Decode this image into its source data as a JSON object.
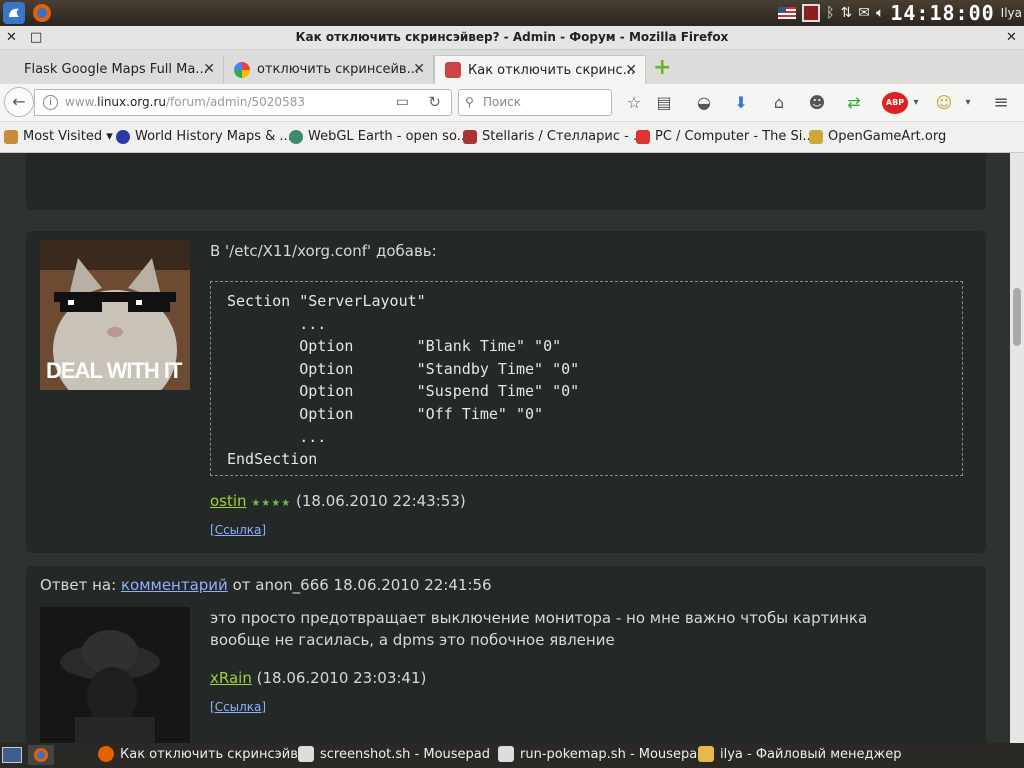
{
  "system_bar": {
    "clock": "14:18:00",
    "user": "Ilya"
  },
  "window": {
    "title": "Как отключить скринсэйвер? - Admin - Форум - Mozilla Firefox",
    "close_symbol": "✕",
    "maximize_symbol": "□",
    "minimize_symbol": "✕"
  },
  "tabs": [
    {
      "label": "Flask Google Maps Full Ma...",
      "active": false
    },
    {
      "label": "отключить скринсейв...",
      "active": false
    },
    {
      "label": "Как отключить скринс...",
      "active": true
    }
  ],
  "new_tab_symbol": "+",
  "navbar": {
    "url_prefix": "www.",
    "url_domain": "linux.org.ru",
    "url_path": "/forum/admin/5020583",
    "search_placeholder": "Поиск"
  },
  "bookmarks": [
    {
      "label": "Most Visited ▾"
    },
    {
      "label": "World History Maps & ..."
    },
    {
      "label": "WebGL Earth - open so..."
    },
    {
      "label": "Stellaris / Стелларис - ..."
    },
    {
      "label": "PC / Computer - The Si..."
    },
    {
      "label": "OpenGameArt.org"
    }
  ],
  "post1": {
    "intro": "В '/etc/X11/xorg.conf' добавь:",
    "code": "Section \"ServerLayout\"\n        ...\n        Option       \"Blank Time\" \"0\"\n        Option       \"Standby Time\" \"0\"\n        Option       \"Suspend Time\" \"0\"\n        Option       \"Off Time\" \"0\"\n        ...\nEndSection",
    "author": "ostin",
    "stars": "★★★★",
    "timestamp": "(18.06.2010 22:43:53)",
    "link_label": "Ссылка",
    "avatar_caption": "DEAL WITH IT"
  },
  "post2": {
    "reply_prefix": "Ответ на:",
    "reply_link": "комментарий",
    "reply_suffix": "от anon_666 18.06.2010 22:41:56",
    "text": "это просто предотвращает выключение монитора - но мне важно чтобы картинка вообще не гасилась, а dpms это побочное явление",
    "author": "xRain",
    "timestamp": "(18.06.2010 23:03:41)",
    "link_label": "Ссылка"
  },
  "taskbar": [
    {
      "label": "Как отключить скринсэйв..."
    },
    {
      "label": "screenshot.sh - Mousepad"
    },
    {
      "label": "run-pokemap.sh - Mousepad"
    },
    {
      "label": "ilya - Файловый менеджер"
    }
  ]
}
